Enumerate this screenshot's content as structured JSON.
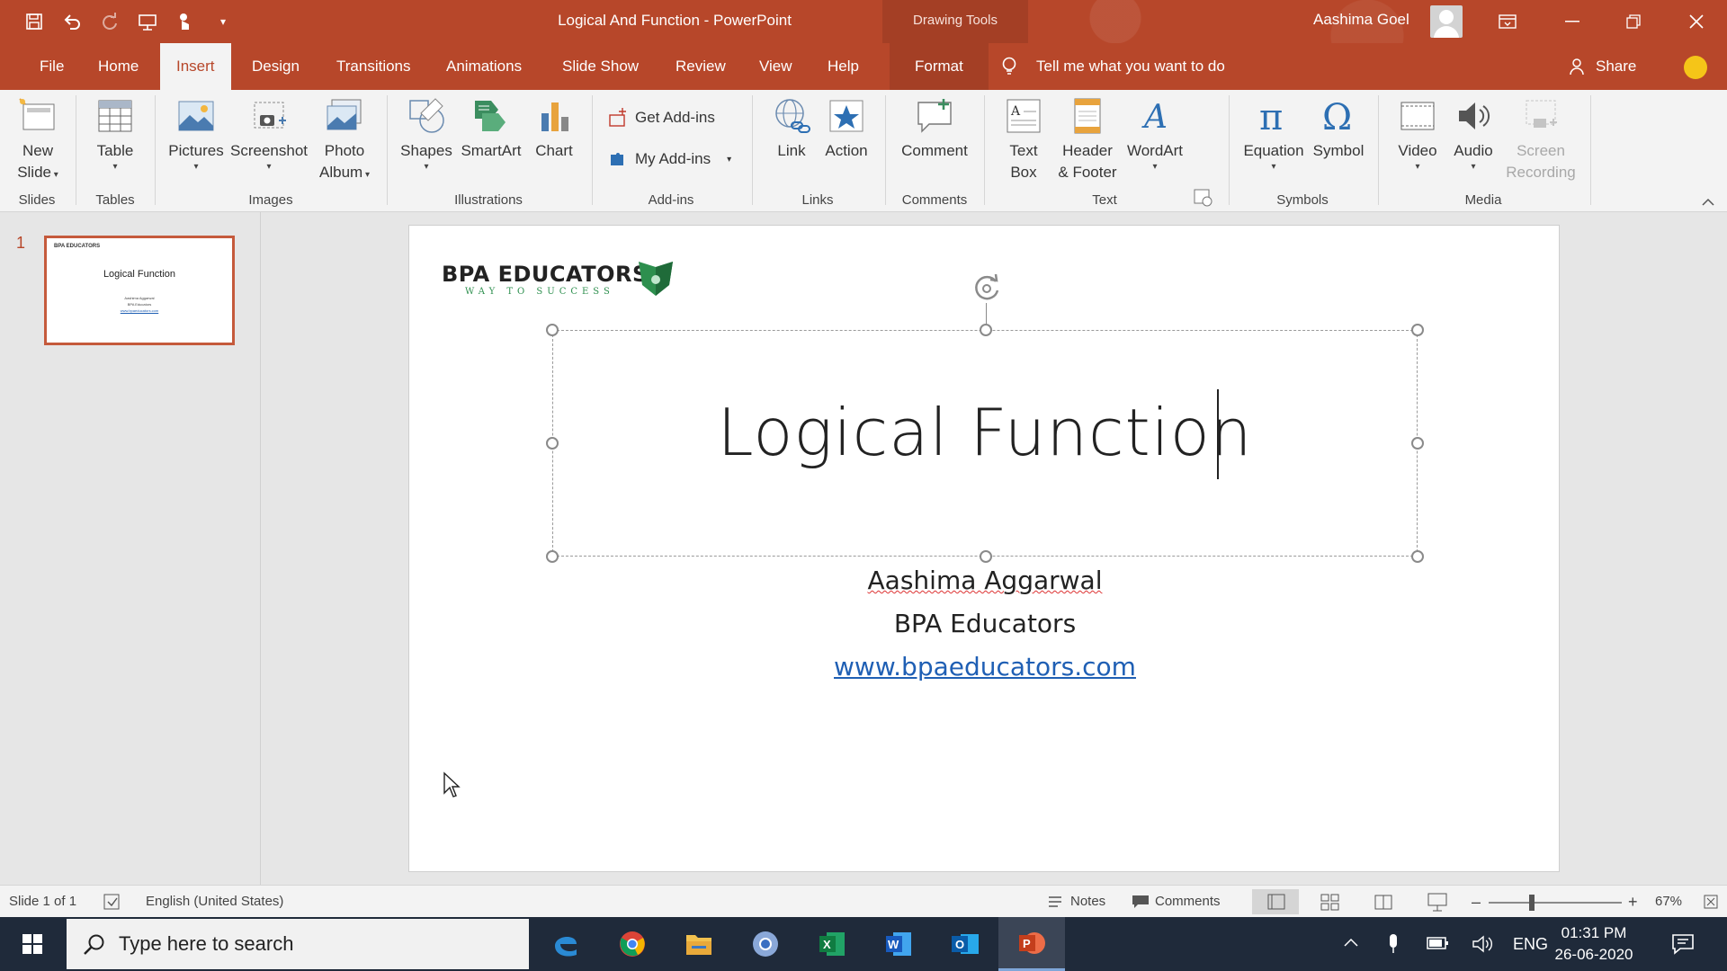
{
  "titlebar": {
    "doc_title": "Logical And Function  -  PowerPoint",
    "context_tab": "Drawing Tools",
    "user_name": "Aashima Goel"
  },
  "tabs": {
    "file": "File",
    "home": "Home",
    "insert": "Insert",
    "design": "Design",
    "transitions": "Transitions",
    "animations": "Animations",
    "slideshow": "Slide Show",
    "review": "Review",
    "view": "View",
    "help": "Help",
    "format": "Format",
    "tellme": "Tell me what you want to do",
    "share": "Share",
    "active": "Insert"
  },
  "ribbon": {
    "new_slide": [
      "New",
      "Slide"
    ],
    "table": "Table",
    "pictures": "Pictures",
    "screenshot": "Screenshot",
    "photo_album": [
      "Photo",
      "Album"
    ],
    "shapes": "Shapes",
    "smartart": "SmartArt",
    "chart": "Chart",
    "get_addins": "Get Add-ins",
    "my_addins": "My Add-ins",
    "link": "Link",
    "action": "Action",
    "comment": "Comment",
    "text_box": [
      "Text",
      "Box"
    ],
    "header_footer": [
      "Header",
      "& Footer"
    ],
    "wordart": "WordArt",
    "equation": "Equation",
    "symbol": "Symbol",
    "video": "Video",
    "audio": "Audio",
    "screen_recording": [
      "Screen",
      "Recording"
    ],
    "groups": {
      "slides": "Slides",
      "tables": "Tables",
      "images": "Images",
      "illustrations": "Illustrations",
      "addins": "Add-ins",
      "links": "Links",
      "comments": "Comments",
      "text": "Text",
      "symbols": "Symbols",
      "media": "Media"
    }
  },
  "thumbnails": {
    "slide_number": "1",
    "thumb_title": "Logical Function"
  },
  "slide": {
    "logo_main": "BPA EDUCATORS",
    "logo_sub": "WAY TO SUCCESS",
    "title": "Logical Function",
    "author": "Aashima Aggarwal",
    "org": "BPA Educators",
    "website": "www.bpaeducators.com"
  },
  "statusbar": {
    "slide_info": "Slide 1 of 1",
    "language": "English (United States)",
    "notes": "Notes",
    "comments": "Comments",
    "zoom": "67%",
    "zoom_minus": "–",
    "zoom_plus": "+"
  },
  "taskbar": {
    "search_placeholder": "Type here to search",
    "lang": "ENG",
    "time": "01:31 PM",
    "date": "26-06-2020"
  },
  "colors": {
    "accent": "#b7472a",
    "link": "#1f5fb4",
    "taskbar": "#1f2a3a"
  }
}
